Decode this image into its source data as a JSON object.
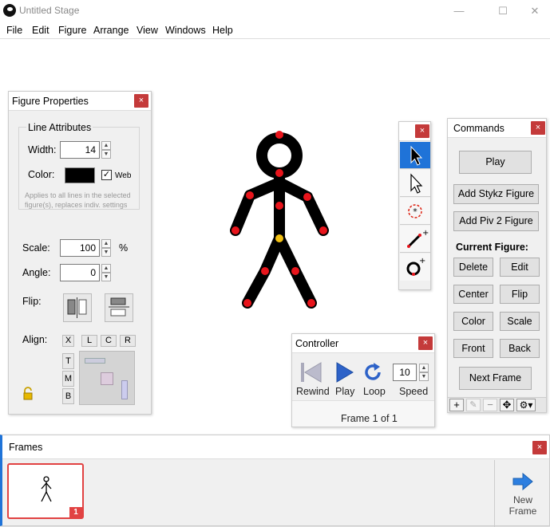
{
  "window": {
    "title": "Untitled Stage"
  },
  "menu": [
    "File",
    "Edit",
    "Figure",
    "Arrange",
    "View",
    "Windows",
    "Help"
  ],
  "figure_properties": {
    "title": "Figure Properties",
    "line_attributes": "Line Attributes",
    "width_label": "Width:",
    "width_value": "14",
    "color_label": "Color:",
    "web_label": "Web",
    "note": "Applies to all lines in the selected figure(s), replaces indiv. settings",
    "scale_label": "Scale:",
    "scale_value": "100",
    "percent": "%",
    "angle_label": "Angle:",
    "angle_value": "0",
    "flip_label": "Flip:",
    "align_label": "Align:",
    "align_x": [
      "X",
      "L",
      "C",
      "R"
    ],
    "align_y": [
      "T",
      "M",
      "B"
    ]
  },
  "commands": {
    "title": "Commands",
    "play": "Play",
    "add_stykz": "Add Stykz Figure",
    "add_piv": "Add Piv 2 Figure",
    "current_figure": "Current Figure:",
    "delete": "Delete",
    "edit": "Edit",
    "center": "Center",
    "flip": "Flip",
    "color": "Color",
    "scale": "Scale",
    "front": "Front",
    "back": "Back",
    "next_frame": "Next Frame"
  },
  "controller": {
    "title": "Controller",
    "rewind": "Rewind",
    "play": "Play",
    "loop": "Loop",
    "speed": "Speed",
    "speed_value": "10",
    "frame_status": "Frame 1 of 1"
  },
  "frames": {
    "title": "Frames",
    "frame_number": "1",
    "new_frame": "New Frame"
  },
  "colors": {
    "accent": "#1f73d8",
    "close": "#c43a3a",
    "joint": "#e8141b",
    "root_joint": "#f2c012"
  },
  "icons": {
    "select": "arrow-pointer-icon",
    "sub_select": "outline-pointer-icon",
    "joint_tool": "joint-circle-icon",
    "add_line": "add-line-icon",
    "add_circle": "add-circle-icon",
    "lock": "lock-icon"
  }
}
